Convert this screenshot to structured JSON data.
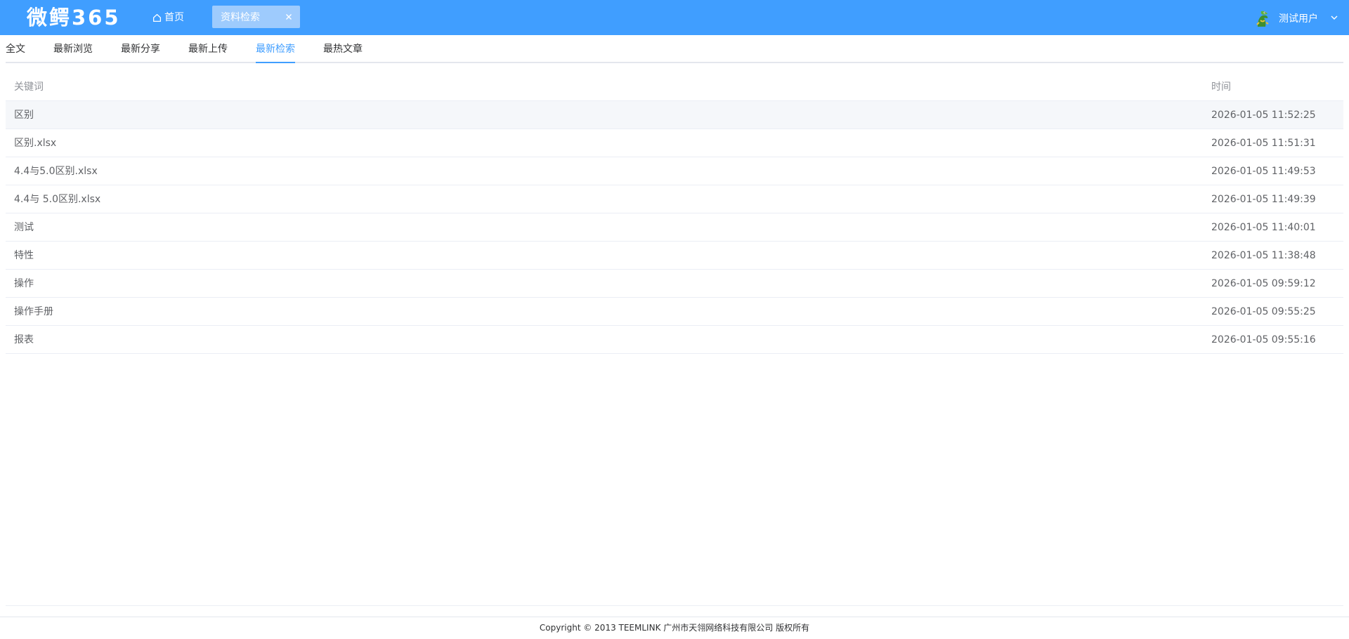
{
  "header": {
    "logo_text": "微鳄365",
    "home_label": "首页",
    "active_page_tab": "资料检索",
    "user_name": "测试用户",
    "bg_color": "#409eff"
  },
  "subnav": {
    "tabs": [
      {
        "label": "全文"
      },
      {
        "label": "最新浏览"
      },
      {
        "label": "最新分享"
      },
      {
        "label": "最新上传"
      },
      {
        "label": "最新检索",
        "active": true
      },
      {
        "label": "最热文章"
      }
    ],
    "active_color": "#409eff"
  },
  "table": {
    "columns": [
      "关键词",
      "时间"
    ],
    "rows": [
      {
        "keyword": "区别",
        "time": "2026-01-05 11:52:25"
      },
      {
        "keyword": "区别.xlsx",
        "time": "2026-01-05 11:51:31"
      },
      {
        "keyword": "4.4与5.0区别.xlsx",
        "time": "2026-01-05 11:49:53"
      },
      {
        "keyword": "4.4与 5.0区别.xlsx",
        "time": "2026-01-05 11:49:39"
      },
      {
        "keyword": "测试",
        "time": "2026-01-05 11:40:01"
      },
      {
        "keyword": "特性",
        "time": "2026-01-05 11:38:48"
      },
      {
        "keyword": "操作",
        "time": "2026-01-05 09:59:12"
      },
      {
        "keyword": "操作手册",
        "time": "2026-01-05 09:55:25"
      },
      {
        "keyword": "报表",
        "time": "2026-01-05 09:55:16"
      }
    ]
  },
  "footer": {
    "copyright": "Copyright © 2013 TEEMLINK 广州市天翎网络科技有限公司 版权所有"
  },
  "icons": {
    "home": "home-icon",
    "close": "close-icon",
    "avatar": "crocodile-avatar-icon",
    "caret": "chevron-down-icon"
  }
}
